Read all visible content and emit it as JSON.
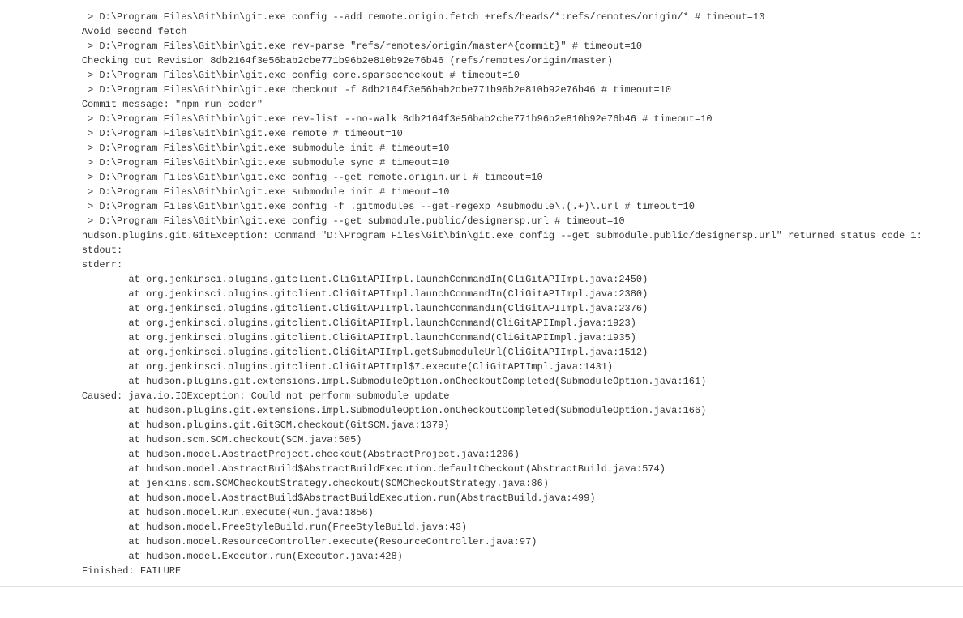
{
  "git_exe": "D:\\Program Files\\Git\\bin\\git.exe",
  "revision": "8db2164f3e56bab2cbe771b96b2e810b92e76b46",
  "branch_ref": "refs/remotes/origin/master",
  "lines": [
    " > D:\\Program Files\\Git\\bin\\git.exe config --add remote.origin.fetch +refs/heads/*:refs/remotes/origin/* # timeout=10",
    "Avoid second fetch",
    " > D:\\Program Files\\Git\\bin\\git.exe rev-parse \"refs/remotes/origin/master^{commit}\" # timeout=10",
    "Checking out Revision 8db2164f3e56bab2cbe771b96b2e810b92e76b46 (refs/remotes/origin/master)",
    " > D:\\Program Files\\Git\\bin\\git.exe config core.sparsecheckout # timeout=10",
    " > D:\\Program Files\\Git\\bin\\git.exe checkout -f 8db2164f3e56bab2cbe771b96b2e810b92e76b46 # timeout=10",
    "Commit message: \"npm run coder\"",
    " > D:\\Program Files\\Git\\bin\\git.exe rev-list --no-walk 8db2164f3e56bab2cbe771b96b2e810b92e76b46 # timeout=10",
    " > D:\\Program Files\\Git\\bin\\git.exe remote # timeout=10",
    " > D:\\Program Files\\Git\\bin\\git.exe submodule init # timeout=10",
    " > D:\\Program Files\\Git\\bin\\git.exe submodule sync # timeout=10",
    " > D:\\Program Files\\Git\\bin\\git.exe config --get remote.origin.url # timeout=10",
    " > D:\\Program Files\\Git\\bin\\git.exe submodule init # timeout=10",
    " > D:\\Program Files\\Git\\bin\\git.exe config -f .gitmodules --get-regexp ^submodule\\.(.+)\\.url # timeout=10",
    " > D:\\Program Files\\Git\\bin\\git.exe config --get submodule.public/designersp.url # timeout=10",
    "hudson.plugins.git.GitException: Command \"D:\\Program Files\\Git\\bin\\git.exe config --get submodule.public/designersp.url\" returned status code 1:",
    "stdout: ",
    "stderr: ",
    "\tat org.jenkinsci.plugins.gitclient.CliGitAPIImpl.launchCommandIn(CliGitAPIImpl.java:2450)",
    "\tat org.jenkinsci.plugins.gitclient.CliGitAPIImpl.launchCommandIn(CliGitAPIImpl.java:2380)",
    "\tat org.jenkinsci.plugins.gitclient.CliGitAPIImpl.launchCommandIn(CliGitAPIImpl.java:2376)",
    "\tat org.jenkinsci.plugins.gitclient.CliGitAPIImpl.launchCommand(CliGitAPIImpl.java:1923)",
    "\tat org.jenkinsci.plugins.gitclient.CliGitAPIImpl.launchCommand(CliGitAPIImpl.java:1935)",
    "\tat org.jenkinsci.plugins.gitclient.CliGitAPIImpl.getSubmoduleUrl(CliGitAPIImpl.java:1512)",
    "\tat org.jenkinsci.plugins.gitclient.CliGitAPIImpl$7.execute(CliGitAPIImpl.java:1431)",
    "\tat hudson.plugins.git.extensions.impl.SubmoduleOption.onCheckoutCompleted(SubmoduleOption.java:161)",
    "Caused: java.io.IOException: Could not perform submodule update",
    "\tat hudson.plugins.git.extensions.impl.SubmoduleOption.onCheckoutCompleted(SubmoduleOption.java:166)",
    "\tat hudson.plugins.git.GitSCM.checkout(GitSCM.java:1379)",
    "\tat hudson.scm.SCM.checkout(SCM.java:505)",
    "\tat hudson.model.AbstractProject.checkout(AbstractProject.java:1206)",
    "\tat hudson.model.AbstractBuild$AbstractBuildExecution.defaultCheckout(AbstractBuild.java:574)",
    "\tat jenkins.scm.SCMCheckoutStrategy.checkout(SCMCheckoutStrategy.java:86)",
    "\tat hudson.model.AbstractBuild$AbstractBuildExecution.run(AbstractBuild.java:499)",
    "\tat hudson.model.Run.execute(Run.java:1856)",
    "\tat hudson.model.FreeStyleBuild.run(FreeStyleBuild.java:43)",
    "\tat hudson.model.ResourceController.execute(ResourceController.java:97)",
    "\tat hudson.model.Executor.run(Executor.java:428)",
    "Finished: FAILURE"
  ],
  "indent_prefix": "              ",
  "tab_replacement": "        "
}
